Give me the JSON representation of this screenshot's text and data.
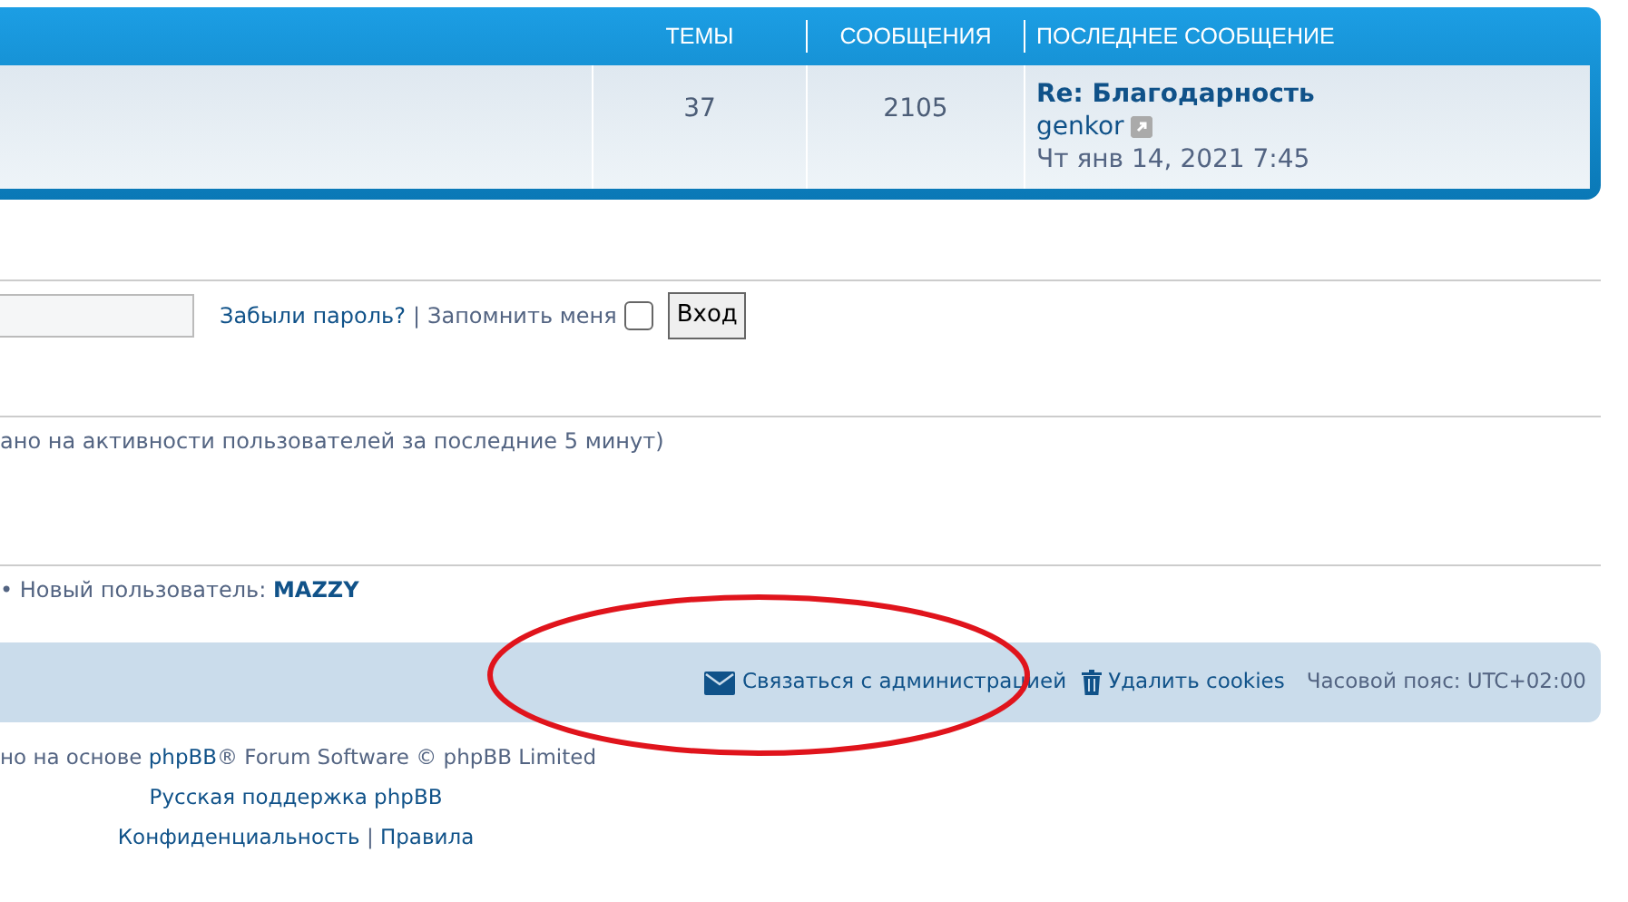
{
  "forum_table": {
    "columns": [
      "ТЕМЫ",
      "СООБЩЕНИЯ",
      "ПОСЛЕДНЕЕ СООБЩЕНИЕ"
    ],
    "row": {
      "topics": "37",
      "posts": "2105",
      "last_post": {
        "title": "Re: Благодарность",
        "author": "genkor",
        "date": "Чт янв 14, 2021 7:45"
      }
    }
  },
  "login": {
    "forgot_link": "Забыли пароль?",
    "separator": "|",
    "remember_label": "Запомнить меня",
    "remember_checked": false,
    "button": "Вход"
  },
  "online": {
    "text": "ано на активности пользователей за последние 5 минут)"
  },
  "stats": {
    "label": "• Новый пользователь:",
    "newest_user": "MAZZY"
  },
  "footer_bar": {
    "links": [
      {
        "kind": "contact",
        "label": "Связаться с администрацией"
      },
      {
        "kind": "cookies",
        "label": "Удалить cookies"
      }
    ],
    "timezone": "Часовой пояс: UTC+02:00"
  },
  "footer": {
    "powered_by": {
      "prefix": "но на основе ",
      "link": "phpBB",
      "suffix": "® Forum Software © phpBB Limited"
    },
    "support_link": "Русская поддержка phpBB",
    "privacy_link": "Конфиденциальность",
    "separator": "|",
    "rules_link": "Правила"
  },
  "annotation": {
    "kind": "ellipse"
  }
}
